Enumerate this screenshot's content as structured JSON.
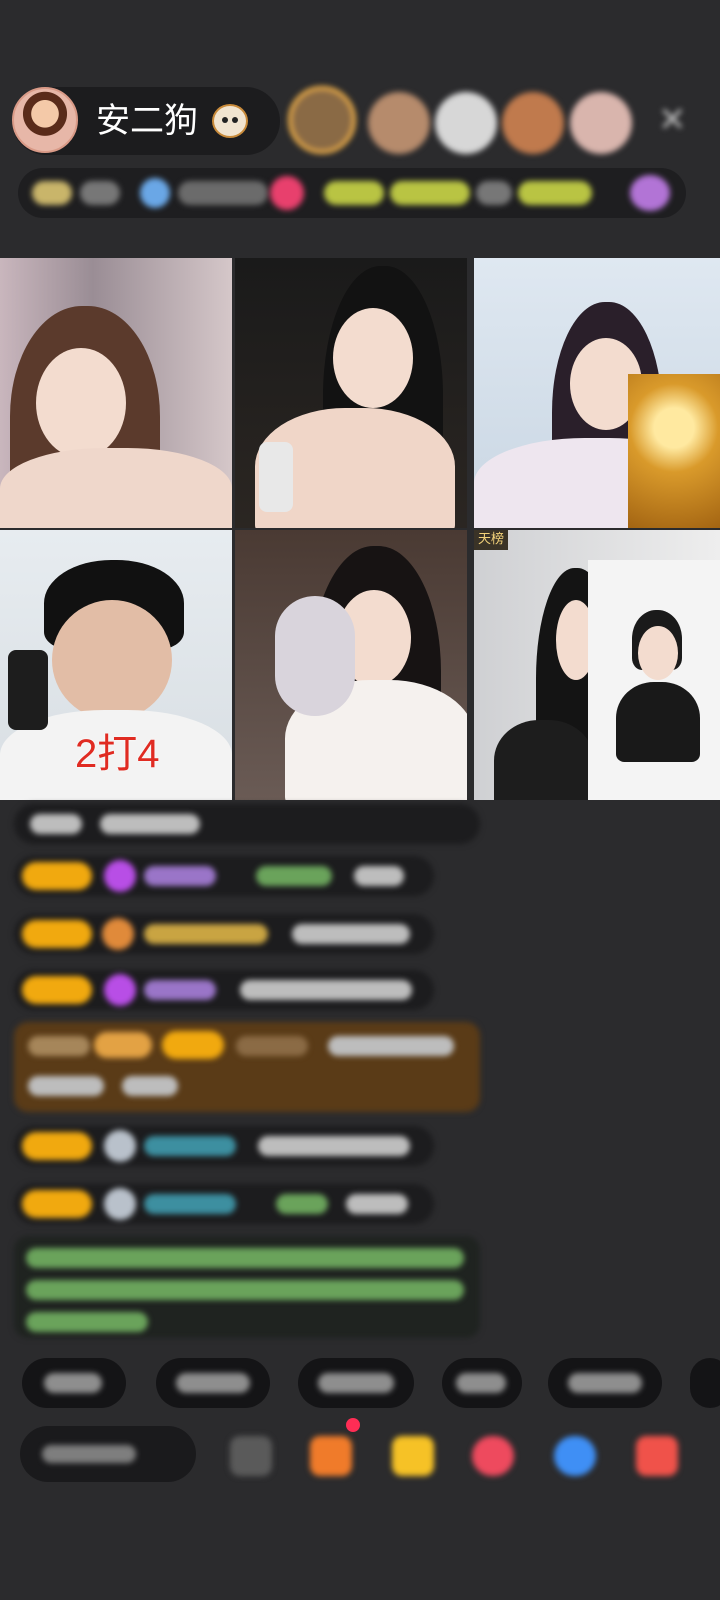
{
  "header": {
    "host_name": "安二狗",
    "host_emoji_icon": "puppy-face-icon",
    "close_icon": "close-icon"
  },
  "video_grid": {
    "tile4_overlay_text": "2打4",
    "tile6_tag": "天榜"
  },
  "colors": {
    "background": "#2b2b2d",
    "badge_gold": "#f1a90f",
    "gem_purple": "#b84ee6",
    "overlay_red": "#e02b22"
  }
}
